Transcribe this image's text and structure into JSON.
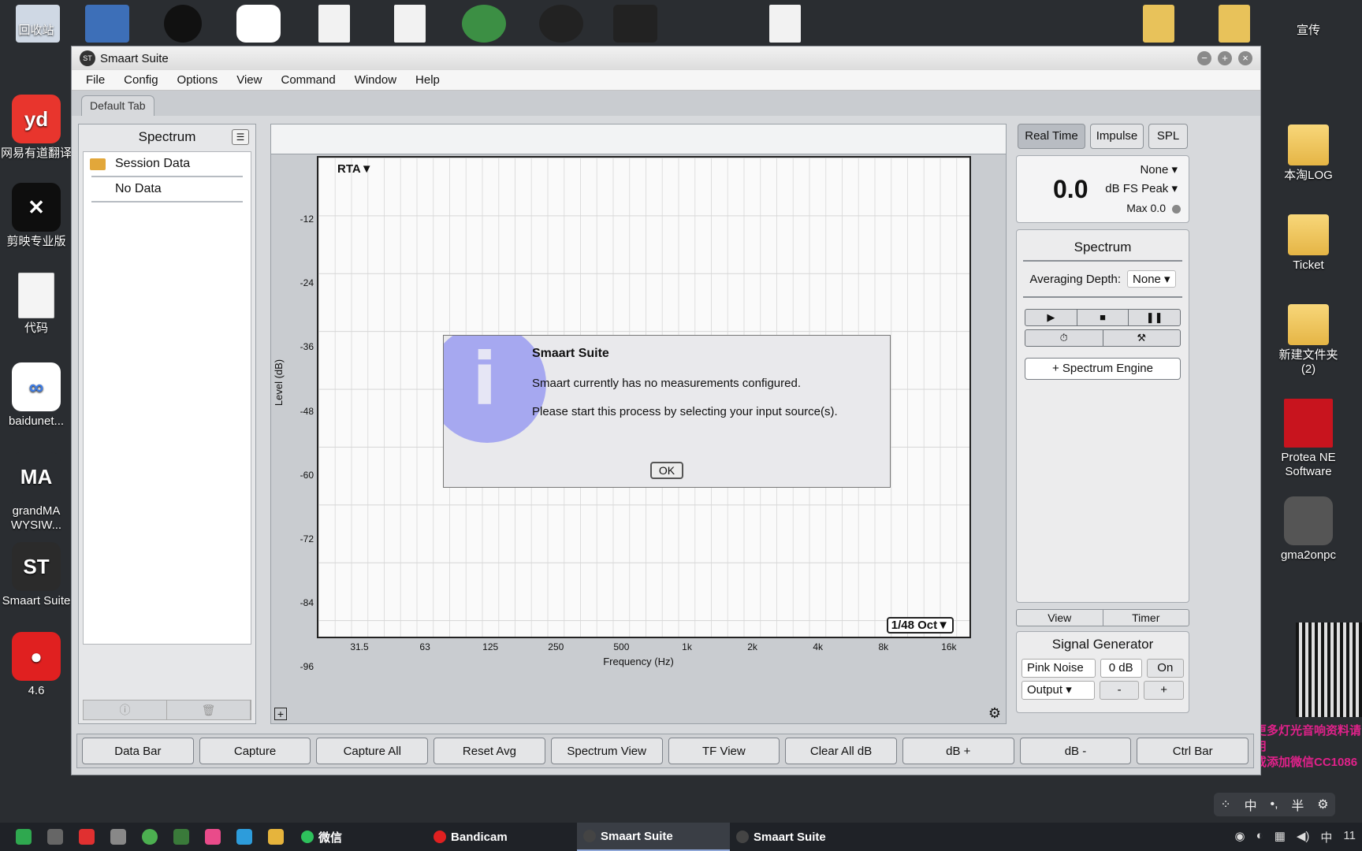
{
  "desktop": {
    "left_icons": [
      {
        "label": "回收站",
        "icon": "recycle-bin-icon",
        "color": "#cfd8e4"
      },
      {
        "label": "网易有道翻译",
        "icon": "youdao-icon",
        "color": "#e8352d",
        "glyph": "yd"
      },
      {
        "label": "剪映专业版",
        "icon": "capcut-icon",
        "color": "#0e0e0e",
        "glyph": "✕"
      },
      {
        "label": "代码",
        "icon": "document-icon",
        "color": "#f4f4f4"
      },
      {
        "label": "baidunet...",
        "icon": "baidunetdisk-icon",
        "color": "#ffffff",
        "glyph": "∞"
      },
      {
        "label": "grandMA WYSIW...",
        "icon": "grandma-icon",
        "color": "#2a2d31",
        "glyph": "MA"
      },
      {
        "label": "Smaart Suite",
        "icon": "smaart-icon",
        "color": "#2b2b2b",
        "glyph": "ST"
      },
      {
        "label": "4.6",
        "icon": "record-icon",
        "color": "#e02020",
        "glyph": "●"
      }
    ],
    "right_icons": [
      {
        "label": "宣传",
        "icon": "file-icon"
      },
      {
        "label": "本淘LOG",
        "icon": "folder-icon"
      },
      {
        "label": "Ticket",
        "icon": "folder-icon"
      },
      {
        "label": "新建文件夹 (2)",
        "icon": "folder-icon"
      },
      {
        "label": "Protea NE Software",
        "icon": "ashly-icon"
      },
      {
        "label": "gma2onpc",
        "icon": "grandma-icon"
      }
    ],
    "promo_text": [
      "更多灯光音响资料请用",
      "或添加微信CC1086"
    ]
  },
  "window": {
    "title": "Smaart Suite",
    "logo": "ST",
    "menu": [
      "File",
      "Config",
      "Options",
      "View",
      "Command",
      "Window",
      "Help"
    ],
    "tab": "Default Tab"
  },
  "left_panel": {
    "title": "Spectrum",
    "session": "Session Data",
    "no_data": "No Data"
  },
  "graph": {
    "rta_label": "RTA▼",
    "resolution": "1/48 Oct▼",
    "xlabel": "Frequency (Hz)",
    "ylabel": "Level (dB)",
    "yticks": [
      "-12",
      "-24",
      "-36",
      "-48",
      "-60",
      "-72",
      "-84",
      "-96"
    ],
    "xticks": [
      "31.5",
      "63",
      "125",
      "250",
      "500",
      "1k",
      "2k",
      "4k",
      "8k",
      "16k"
    ]
  },
  "right_panel": {
    "modes": [
      "Real Time",
      "Impulse",
      "SPL"
    ],
    "meter": {
      "value": "0.0",
      "source": "None",
      "unit": "dB FS Peak",
      "max": "Max 0.0"
    },
    "spectrum_title": "Spectrum",
    "avg_label": "Averaging Depth:",
    "avg_value": "None",
    "transport": [
      "▶",
      "■",
      "❚❚"
    ],
    "transport2": [
      "⏱",
      "⚒"
    ],
    "engine_button": "+ Spectrum Engine",
    "view_label": "View",
    "timer_label": "Timer",
    "siggen_title": "Signal Generator",
    "noise": "Pink Noise",
    "level": "0 dB",
    "on": "On",
    "output": "Output",
    "minus": "-",
    "plus": "+"
  },
  "bottom_buttons": [
    "Data Bar",
    "Capture",
    "Capture All",
    "Reset Avg",
    "Spectrum View",
    "TF View",
    "Clear All dB",
    "dB +",
    "dB -",
    "Ctrl Bar"
  ],
  "dialog": {
    "title": "Smaart Suite",
    "line1": "Smaart currently has no measurements configured.",
    "line2": "Please start this process by selecting your input source(s).",
    "ok": "OK"
  },
  "ime": [
    "中",
    "半"
  ],
  "taskbar": {
    "apps": [
      {
        "label": "微信",
        "active": false
      },
      {
        "label": "Bandicam",
        "active": false
      },
      {
        "label": "Smaart Suite",
        "active": true
      },
      {
        "label": "Smaart Suite",
        "active": false
      }
    ],
    "tray_lang": "中",
    "clock": "11"
  }
}
